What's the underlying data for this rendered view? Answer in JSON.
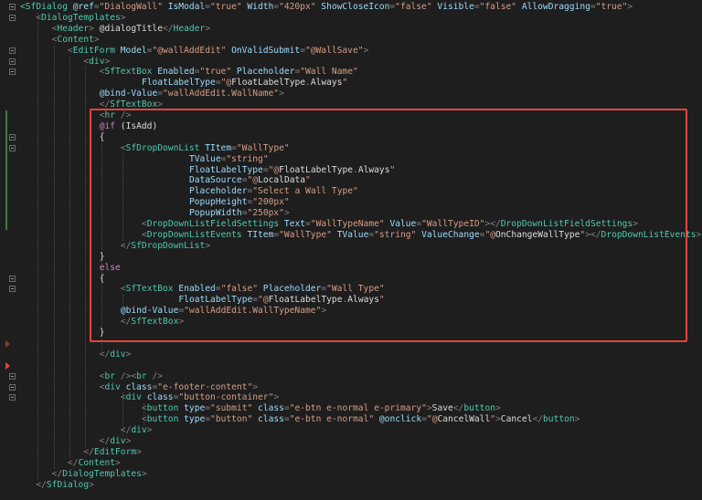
{
  "editor": {
    "lines": [
      [
        [
          "t",
          "<"
        ],
        [
          "t",
          "SfDialog "
        ],
        [
          "a",
          "@ref"
        ],
        [
          "p",
          "="
        ],
        [
          "s",
          "\"DialogWall\" "
        ],
        [
          "a",
          "IsModal"
        ],
        [
          "p",
          "="
        ],
        [
          "s",
          "\"true\" "
        ],
        [
          "a",
          "Width"
        ],
        [
          "p",
          "="
        ],
        [
          "s",
          "\"420px\" "
        ],
        [
          "a",
          "ShowCloseIcon"
        ],
        [
          "p",
          "="
        ],
        [
          "s",
          "\"false\" "
        ],
        [
          "a",
          "Visible"
        ],
        [
          "p",
          "="
        ],
        [
          "s",
          "\"false\" "
        ],
        [
          "a",
          "AllowDragging"
        ],
        [
          "p",
          "="
        ],
        [
          "s",
          "\"true\""
        ],
        [
          "p",
          ">"
        ]
      ],
      [
        [
          "p",
          "<"
        ],
        [
          "t",
          "DialogTemplates"
        ],
        [
          "p",
          ">"
        ]
      ],
      [
        [
          "p",
          "<"
        ],
        [
          "t",
          "Header"
        ],
        [
          "p",
          "> "
        ],
        [
          "x",
          "@dialogTitle"
        ],
        [
          "p",
          "</"
        ],
        [
          "t",
          "Header"
        ],
        [
          "p",
          ">"
        ]
      ],
      [
        [
          "p",
          "<"
        ],
        [
          "t",
          "Content"
        ],
        [
          "p",
          ">"
        ]
      ],
      [
        [
          "p",
          "<"
        ],
        [
          "t",
          "EditForm "
        ],
        [
          "a",
          "Model"
        ],
        [
          "p",
          "="
        ],
        [
          "s",
          "\"@wallAddEdit\" "
        ],
        [
          "a",
          "OnValidSubmit"
        ],
        [
          "p",
          "="
        ],
        [
          "s",
          "\"@WallSave\""
        ],
        [
          "p",
          ">"
        ]
      ],
      [
        [
          "p",
          "<"
        ],
        [
          "t",
          "div"
        ],
        [
          "p",
          ">"
        ]
      ],
      [
        [
          "p",
          "<"
        ],
        [
          "t",
          "SfTextBox "
        ],
        [
          "a",
          "Enabled"
        ],
        [
          "p",
          "="
        ],
        [
          "s",
          "\"true\" "
        ],
        [
          "a",
          "Placeholder"
        ],
        [
          "p",
          "="
        ],
        [
          "s",
          "\"Wall Name\""
        ]
      ],
      [
        [
          "a",
          "FloatLabelType"
        ],
        [
          "p",
          "="
        ],
        [
          "s",
          "\"@"
        ],
        [
          "x",
          "FloatLabelType"
        ],
        [
          "p",
          "."
        ],
        [
          "x",
          "Always"
        ],
        [
          "s",
          "\""
        ]
      ],
      [
        [
          "a",
          "@bind-Value"
        ],
        [
          "p",
          "="
        ],
        [
          "s",
          "\"wallAddEdit.WallName\""
        ],
        [
          "p",
          ">"
        ]
      ],
      [
        [
          "p",
          "</"
        ],
        [
          "t",
          "SfTextBox"
        ],
        [
          "p",
          ">"
        ]
      ],
      [
        [
          "p",
          "<"
        ],
        [
          "t",
          "hr "
        ],
        [
          "p",
          "/>"
        ]
      ],
      [
        [
          "k",
          "@if "
        ],
        [
          "x",
          "(IsAdd)"
        ]
      ],
      [
        [
          "x",
          "{"
        ]
      ],
      [
        [
          "p",
          "<"
        ],
        [
          "t",
          "SfDropDownList "
        ],
        [
          "a",
          "TItem"
        ],
        [
          "p",
          "="
        ],
        [
          "s",
          "\"WallType\""
        ]
      ],
      [
        [
          "a",
          "TValue"
        ],
        [
          "p",
          "="
        ],
        [
          "s",
          "\"string\""
        ]
      ],
      [
        [
          "a",
          "FloatLabelType"
        ],
        [
          "p",
          "="
        ],
        [
          "s",
          "\"@"
        ],
        [
          "x",
          "FloatLabelType"
        ],
        [
          "p",
          "."
        ],
        [
          "x",
          "Always"
        ],
        [
          "s",
          "\""
        ]
      ],
      [
        [
          "a",
          "DataSource"
        ],
        [
          "p",
          "="
        ],
        [
          "s",
          "\"@"
        ],
        [
          "x",
          "LocalData"
        ],
        [
          "s",
          "\""
        ]
      ],
      [
        [
          "a",
          "Placeholder"
        ],
        [
          "p",
          "="
        ],
        [
          "s",
          "\"Select a Wall Type\""
        ]
      ],
      [
        [
          "a",
          "PopupHeight"
        ],
        [
          "p",
          "="
        ],
        [
          "s",
          "\"200px\""
        ]
      ],
      [
        [
          "a",
          "PopupWidth"
        ],
        [
          "p",
          "="
        ],
        [
          "s",
          "\"250px\""
        ],
        [
          "p",
          ">"
        ]
      ],
      [
        [
          "p",
          "<"
        ],
        [
          "t",
          "DropDownListFieldSettings "
        ],
        [
          "a",
          "Text"
        ],
        [
          "p",
          "="
        ],
        [
          "s",
          "\"WallTypeName\" "
        ],
        [
          "a",
          "Value"
        ],
        [
          "p",
          "="
        ],
        [
          "s",
          "\"WallTypeID\""
        ],
        [
          "p",
          "></"
        ],
        [
          "t",
          "DropDownListFieldSettings"
        ],
        [
          "p",
          ">"
        ]
      ],
      [
        [
          "p",
          "<"
        ],
        [
          "t",
          "DropDownListEvents "
        ],
        [
          "a",
          "TItem"
        ],
        [
          "p",
          "="
        ],
        [
          "s",
          "\"WallType\" "
        ],
        [
          "a",
          "TValue"
        ],
        [
          "p",
          "="
        ],
        [
          "s",
          "\"string\" "
        ],
        [
          "a",
          "ValueChange"
        ],
        [
          "p",
          "="
        ],
        [
          "s",
          "\"@"
        ],
        [
          "x",
          "OnChangeWallType"
        ],
        [
          "s",
          "\""
        ],
        [
          "p",
          "></"
        ],
        [
          "t",
          "DropDownListEvents"
        ],
        [
          "p",
          ">"
        ]
      ],
      [
        [
          "p",
          "</"
        ],
        [
          "t",
          "SfDropDownList"
        ],
        [
          "p",
          ">"
        ]
      ],
      [
        [
          "x",
          "}"
        ]
      ],
      [
        [
          "k",
          "else"
        ]
      ],
      [
        [
          "x",
          "{"
        ]
      ],
      [
        [
          "p",
          "<"
        ],
        [
          "t",
          "SfTextBox "
        ],
        [
          "a",
          "Enabled"
        ],
        [
          "p",
          "="
        ],
        [
          "s",
          "\"false\" "
        ],
        [
          "a",
          "Placeholder"
        ],
        [
          "p",
          "="
        ],
        [
          "s",
          "\"Wall Type\""
        ]
      ],
      [
        [
          "a",
          "FloatLabelType"
        ],
        [
          "p",
          "="
        ],
        [
          "s",
          "\"@"
        ],
        [
          "x",
          "FloatLabelType"
        ],
        [
          "p",
          "."
        ],
        [
          "x",
          "Always"
        ],
        [
          "s",
          "\""
        ]
      ],
      [
        [
          "a",
          "@bind-Value"
        ],
        [
          "p",
          "="
        ],
        [
          "s",
          "\"wallAddEdit.WallTypeName\""
        ],
        [
          "p",
          ">"
        ]
      ],
      [
        [
          "p",
          "</"
        ],
        [
          "t",
          "SfTextBox"
        ],
        [
          "p",
          ">"
        ]
      ],
      [
        [
          "x",
          "}"
        ]
      ],
      [],
      [
        [
          "p",
          "</"
        ],
        [
          "t",
          "div"
        ],
        [
          "p",
          ">"
        ]
      ],
      [],
      [
        [
          "p",
          "<"
        ],
        [
          "t",
          "br "
        ],
        [
          "p",
          "/><"
        ],
        [
          "t",
          "br "
        ],
        [
          "p",
          "/>"
        ]
      ],
      [
        [
          "p",
          "<"
        ],
        [
          "t",
          "div "
        ],
        [
          "a",
          "class"
        ],
        [
          "p",
          "="
        ],
        [
          "s",
          "\"e-footer-content\""
        ],
        [
          "p",
          ">"
        ]
      ],
      [
        [
          "p",
          "<"
        ],
        [
          "t",
          "div "
        ],
        [
          "a",
          "class"
        ],
        [
          "p",
          "="
        ],
        [
          "s",
          "\"button-container\""
        ],
        [
          "p",
          ">"
        ]
      ],
      [
        [
          "p",
          "<"
        ],
        [
          "t",
          "button "
        ],
        [
          "a",
          "type"
        ],
        [
          "p",
          "="
        ],
        [
          "s",
          "\"submit\" "
        ],
        [
          "a",
          "class"
        ],
        [
          "p",
          "="
        ],
        [
          "s",
          "\"e-btn e-normal e-primary\""
        ],
        [
          "p",
          ">"
        ],
        [
          "x",
          "Save"
        ],
        [
          "p",
          "</"
        ],
        [
          "t",
          "button"
        ],
        [
          "p",
          ">"
        ]
      ],
      [
        [
          "p",
          "<"
        ],
        [
          "t",
          "button "
        ],
        [
          "a",
          "type"
        ],
        [
          "p",
          "="
        ],
        [
          "s",
          "\"button\" "
        ],
        [
          "a",
          "class"
        ],
        [
          "p",
          "="
        ],
        [
          "s",
          "\"e-btn e-normal\" "
        ],
        [
          "a",
          "@onclick"
        ],
        [
          "p",
          "="
        ],
        [
          "s",
          "\"@"
        ],
        [
          "x",
          "CancelWall"
        ],
        [
          "s",
          "\""
        ],
        [
          "p",
          ">"
        ],
        [
          "x",
          "Cancel"
        ],
        [
          "p",
          "</"
        ],
        [
          "t",
          "button"
        ],
        [
          "p",
          ">"
        ]
      ],
      [
        [
          "p",
          "</"
        ],
        [
          "t",
          "div"
        ],
        [
          "p",
          ">"
        ]
      ],
      [
        [
          "p",
          "</"
        ],
        [
          "t",
          "div"
        ],
        [
          "p",
          ">"
        ]
      ],
      [
        [
          "p",
          "</"
        ],
        [
          "t",
          "EditForm"
        ],
        [
          "p",
          ">"
        ]
      ],
      [
        [
          "p",
          "</"
        ],
        [
          "t",
          "Content"
        ],
        [
          "p",
          ">"
        ]
      ],
      [
        [
          "p",
          "</"
        ],
        [
          "t",
          "DialogTemplates"
        ],
        [
          "p",
          ">"
        ]
      ],
      [
        [
          "p",
          "</"
        ],
        [
          "t",
          "SfDialog"
        ],
        [
          "p",
          ">"
        ]
      ]
    ]
  },
  "theme": {
    "highlight_border": "#e2453c",
    "background": "#1e1e1e"
  }
}
